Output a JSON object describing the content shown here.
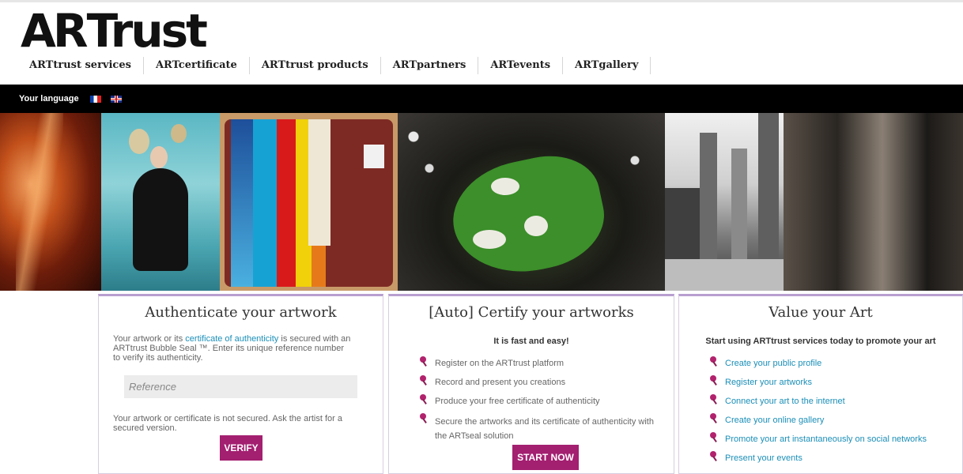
{
  "header": {
    "logo_art": "AR",
    "logo_trust": "Trust",
    "nav": [
      "ARTtrust services",
      "ARTcertificate",
      "ARTtrust products",
      "ARTpartners",
      "ARTevents",
      "ARTgallery"
    ]
  },
  "language": {
    "label": "Your language"
  },
  "cards": {
    "authenticate": {
      "title": "Authenticate your artwork",
      "text_before": "Your artwork or its ",
      "link": "certificate of authenticity",
      "text_after": " is secured with an ARTtrust Bubble Seal ™. Enter its unique reference number to verify its authenticity.",
      "input_placeholder": "Reference",
      "note": "Your artwork or certificate is not secured. Ask the artist for a secured version.",
      "button": "VERIFY"
    },
    "certify": {
      "title": "[Auto] Certify your artworks",
      "subtitle": "It is fast and easy!",
      "items": [
        "Register on the ARTtrust platform",
        "Record and present you creations",
        "Produce your free certificate of authenticity",
        "Secure the artworks and its certificate of authenticity with the ARTseal solution"
      ],
      "button": "START NOW"
    },
    "value": {
      "title": "Value your Art",
      "subtitle": "Start using ARTtrust services today to promote your art",
      "items": [
        "Create your public profile",
        "Register your artworks",
        "Connect your art to the internet",
        "Create your online gallery",
        "Promote your art instantaneously on social networks",
        "Present your events"
      ]
    }
  }
}
